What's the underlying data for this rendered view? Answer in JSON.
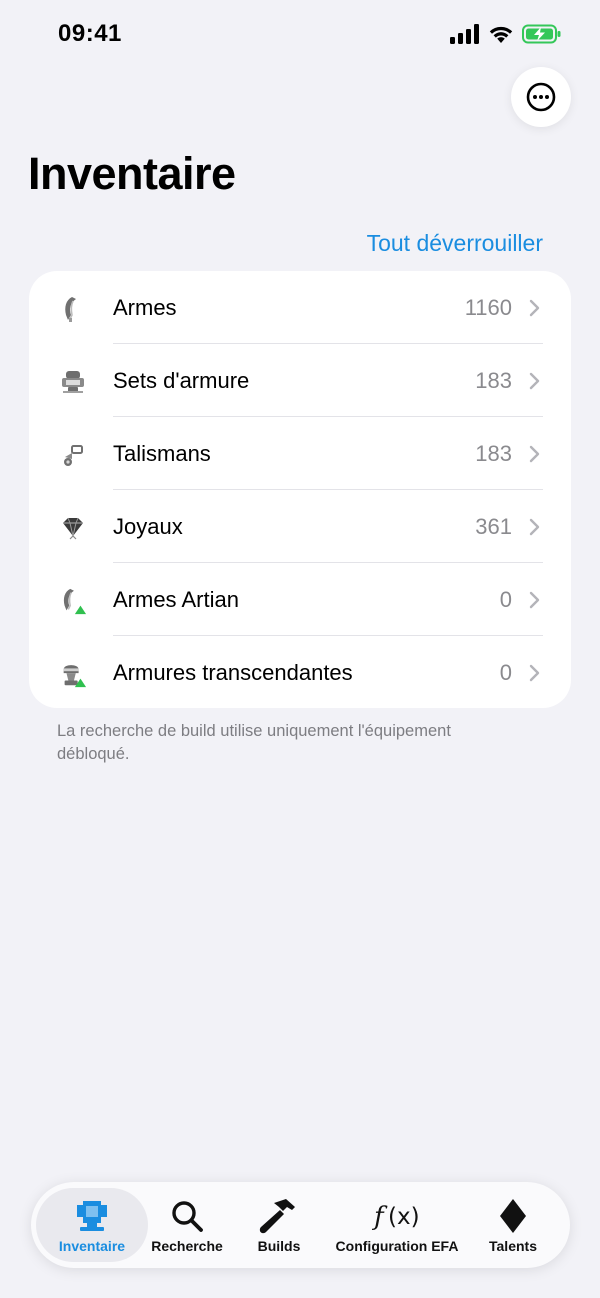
{
  "status_bar": {
    "time": "09:41"
  },
  "page": {
    "title": "Inventaire",
    "unlock_all_label": "Tout déverrouiller"
  },
  "inventory_rows": [
    {
      "label": "Armes",
      "count": "1160",
      "icon": "weapon-icon"
    },
    {
      "label": "Sets d'armure",
      "count": "183",
      "icon": "armor-set-icon"
    },
    {
      "label": "Talismans",
      "count": "183",
      "icon": "talisman-icon"
    },
    {
      "label": "Joyaux",
      "count": "361",
      "icon": "jewel-icon"
    },
    {
      "label": "Armes Artian",
      "count": "0",
      "icon": "artian-weapon-icon"
    },
    {
      "label": "Armures transcendantes",
      "count": "0",
      "icon": "transcendent-armor-icon"
    }
  ],
  "footnote": "La recherche de build utilise uniquement l'équipement débloqué.",
  "tab_bar": {
    "tabs": [
      {
        "label": "Inventaire",
        "icon": "armor-icon",
        "active": true
      },
      {
        "label": "Recherche",
        "icon": "search-icon",
        "active": false
      },
      {
        "label": "Builds",
        "icon": "hammer-icon",
        "active": false
      },
      {
        "label": "Configuration EFA",
        "icon": "function-icon",
        "active": false
      },
      {
        "label": "Talents",
        "icon": "diamond-icon",
        "active": false
      }
    ]
  },
  "colors": {
    "accent": "#1a8de0",
    "background": "#f2f2f7",
    "battery": "#34c759",
    "badge_green": "#30c04f"
  }
}
